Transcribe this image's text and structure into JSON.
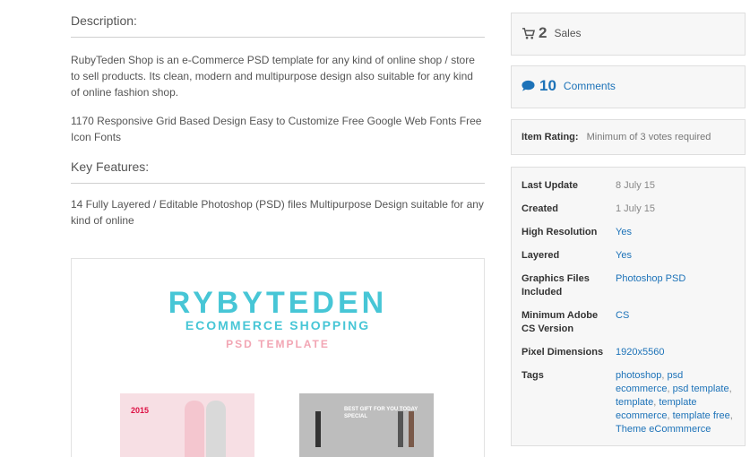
{
  "description": {
    "title": "Description:",
    "paragraph1": "RubyTeden Shop is an e-Commerce PSD template for any kind of online shop / store to sell products. Its clean, modern and multipurpose design also suitable for any kind of online fashion shop.",
    "paragraph2": "1170 Responsive Grid Based Design Easy to Customize Free Google Web Fonts Free Icon Fonts"
  },
  "key_features": {
    "title": "Key Features:",
    "paragraph": "14 Fully Layered / Editable Photoshop (PSD) files Multipurpose Design suitable for any kind of online"
  },
  "preview": {
    "brand": "RYBYTEDEN",
    "subtitle": "ECOMMERCE SHOPPING",
    "subtitle2": "PSD TEMPLATE",
    "thumb1_year": "2015",
    "thumb2_text": "BEST GIFT FOR YOU TODAY SPECIAL"
  },
  "sales": {
    "count": "2",
    "label": "Sales",
    "icon": "cart-icon"
  },
  "comments": {
    "count": "10",
    "label": "Comments",
    "icon": "speech-bubble-icon",
    "color": "#1c72b8"
  },
  "rating": {
    "label": "Item Rating:",
    "value": "Minimum of 3 votes required"
  },
  "attributes": [
    {
      "key": "Last Update",
      "value": "8 July 15"
    },
    {
      "key": "Created",
      "value": "1 July 15"
    },
    {
      "key": "High Resolution",
      "value": "Yes"
    },
    {
      "key": "Layered",
      "value": "Yes"
    },
    {
      "key": "Graphics Files Included",
      "value": "Photoshop PSD"
    },
    {
      "key": "Minimum Adobe CS Version",
      "value": "CS"
    },
    {
      "key": "Pixel Dimensions",
      "value": "1920x5560"
    },
    {
      "key": "Tags",
      "value": ""
    }
  ],
  "tags": [
    "photoshop",
    "psd ecommerce",
    "psd template",
    "template",
    "template ecommerce",
    "template free",
    "Theme eCommmerce"
  ],
  "colors": {
    "link": "#1c72b8",
    "brand_teal": "#47c6d6",
    "brand_pink": "#f2a6b4"
  }
}
